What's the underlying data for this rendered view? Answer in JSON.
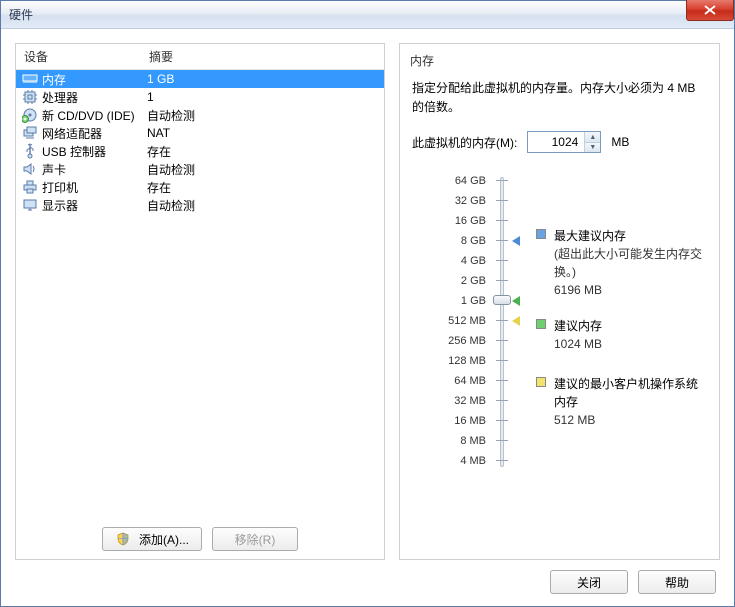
{
  "window": {
    "title": "硬件"
  },
  "list": {
    "headers": {
      "device": "设备",
      "summary": "摘要"
    },
    "items": [
      {
        "name": "内存",
        "summary": "1 GB",
        "icon": "memory",
        "selected": true
      },
      {
        "name": "处理器",
        "summary": "1",
        "icon": "cpu",
        "selected": false
      },
      {
        "name": "新 CD/DVD (IDE)",
        "summary": "自动检测",
        "icon": "cd",
        "selected": false
      },
      {
        "name": "网络适配器",
        "summary": "NAT",
        "icon": "network",
        "selected": false
      },
      {
        "name": "USB 控制器",
        "summary": "存在",
        "icon": "usb",
        "selected": false
      },
      {
        "name": "声卡",
        "summary": "自动检测",
        "icon": "sound",
        "selected": false
      },
      {
        "name": "打印机",
        "summary": "存在",
        "icon": "printer",
        "selected": false
      },
      {
        "name": "显示器",
        "summary": "自动检测",
        "icon": "display",
        "selected": false
      }
    ]
  },
  "buttons": {
    "add": "添加(A)...",
    "remove": "移除(R)",
    "close": "关闭",
    "help": "帮助"
  },
  "memory": {
    "title": "内存",
    "desc": "指定分配给此虚拟机的内存量。内存大小必须为 4 MB 的倍数。",
    "label": "此虚拟机的内存(M):",
    "value": "1024",
    "unit": "MB",
    "ticks": [
      "64 GB",
      "32 GB",
      "16 GB",
      "8 GB",
      "4 GB",
      "2 GB",
      "1 GB",
      "512 MB",
      "256 MB",
      "128 MB",
      "64 MB",
      "32 MB",
      "16 MB",
      "8 MB",
      "4 MB"
    ],
    "legend": {
      "max": {
        "title": "最大建议内存",
        "note": "(超出此大小可能发生内存交换。)",
        "value": "6196 MB"
      },
      "rec": {
        "title": "建议内存",
        "value": "1024 MB"
      },
      "min": {
        "title": "建议的最小客户机操作系统内存",
        "value": "512 MB"
      }
    }
  }
}
